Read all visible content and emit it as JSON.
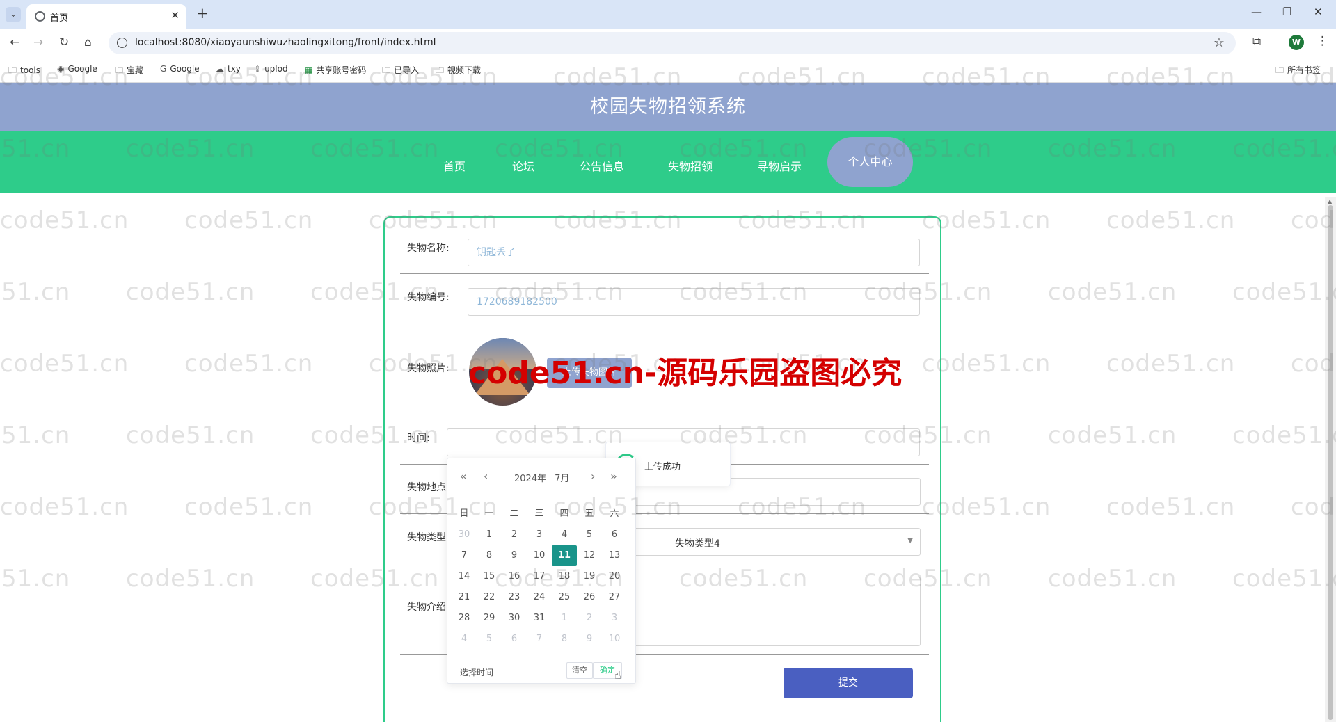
{
  "browser": {
    "tab_title": "首页",
    "url": "localhost:8080/xiaoyaunshiwuzhaolingxitong/front/index.html",
    "bookmarks": [
      {
        "label": "tools",
        "icon": "folder-icon"
      },
      {
        "label": "Google",
        "icon": "globe-icon"
      },
      {
        "label": "宝藏",
        "icon": "folder-icon"
      },
      {
        "label": "Google",
        "icon": "google-icon"
      },
      {
        "label": "txy",
        "icon": "cloud-icon"
      },
      {
        "label": "uplod",
        "icon": "upload-icon"
      },
      {
        "label": "共享账号密码",
        "icon": "sheet-icon"
      },
      {
        "label": "已导入",
        "icon": "folder-icon"
      },
      {
        "label": "视频下载",
        "icon": "folder-icon"
      }
    ],
    "all_bookmarks": "所有书签",
    "profile_initial": "W"
  },
  "site": {
    "title": "校园失物招领系统",
    "nav": [
      "首页",
      "论坛",
      "公告信息",
      "失物招领",
      "寻物启示",
      "个人中心"
    ],
    "active_nav": "个人中心"
  },
  "form": {
    "name_label": "失物名称:",
    "name_placeholder": "钥匙丢了",
    "code_label": "失物编号:",
    "code_value": "1720689182500",
    "photo_label": "失物照片:",
    "upload_label": "上传失物图片",
    "time_label": "时间:",
    "location_label": "失物地点",
    "type_label": "失物类型",
    "type_value": "失物类型4",
    "intro_label": "失物介绍",
    "submit_label": "提交"
  },
  "toast": {
    "text": "上传成功"
  },
  "datepicker": {
    "year": "2024年",
    "month": "7月",
    "weekdays": [
      "日",
      "一",
      "二",
      "三",
      "四",
      "五",
      "六"
    ],
    "weeks": [
      [
        30,
        1,
        2,
        3,
        4,
        5,
        6
      ],
      [
        7,
        8,
        9,
        10,
        11,
        12,
        13
      ],
      [
        14,
        15,
        16,
        17,
        18,
        19,
        20
      ],
      [
        21,
        22,
        23,
        24,
        25,
        26,
        27
      ],
      [
        28,
        29,
        30,
        31,
        1,
        2,
        3
      ],
      [
        4,
        5,
        6,
        7,
        8,
        9,
        10
      ]
    ],
    "selected": 11,
    "select_time_label": "选择时间",
    "clear_label": "清空",
    "ok_label": "确定"
  },
  "watermark": {
    "text": "code51.cn",
    "banner": "code51.cn-源码乐园盗图必究"
  },
  "colors": {
    "header": "#8fa3cf",
    "nav": "#2ecc8a",
    "submit": "#4a5fc1",
    "selected_day": "#19948a"
  }
}
